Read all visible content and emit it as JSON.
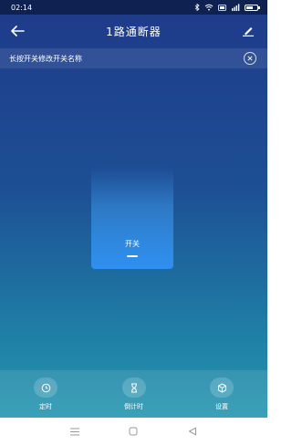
{
  "status_bar": {
    "time": "02:14",
    "signal_text": "⁴ᴳ"
  },
  "header": {
    "title": "1路通断器",
    "back_icon": "arrow-left-icon",
    "edit_icon": "pencil-icon"
  },
  "hint": {
    "text": "长按开关修改开关名称",
    "close_icon": "close-circle-icon"
  },
  "switch": {
    "label": "开关",
    "state": "on"
  },
  "bottom_tabs": [
    {
      "label": "定时",
      "icon": "clock-icon"
    },
    {
      "label": "倒计时",
      "icon": "hourglass-icon"
    },
    {
      "label": "设置",
      "icon": "settings-cube-icon"
    }
  ],
  "system_nav": {
    "menu_icon": "menu-icon",
    "home_icon": "home-square-icon",
    "back_icon": "back-triangle-icon"
  },
  "colors": {
    "status_bar": "#0e2150",
    "bg_top": "#1f3a8a",
    "bg_bottom": "#2596b0",
    "switch_on": "#2f8ff0"
  }
}
